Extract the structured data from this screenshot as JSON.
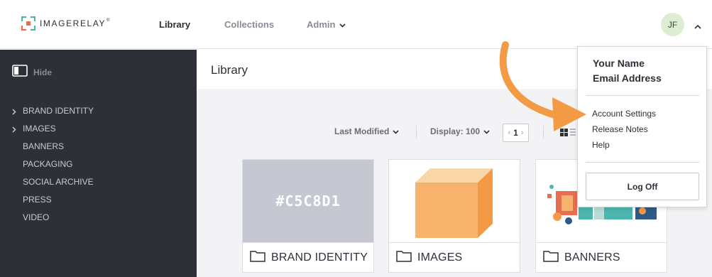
{
  "brand": {
    "name": "IMAGERELAY",
    "reg": "®"
  },
  "nav": {
    "library": "Library",
    "collections": "Collections",
    "admin": "Admin"
  },
  "user": {
    "initials": "JF"
  },
  "sidebar": {
    "hide_label": "Hide",
    "items": [
      {
        "label": "BRAND IDENTITY",
        "expandable": true
      },
      {
        "label": "IMAGES",
        "expandable": true
      },
      {
        "label": "BANNERS",
        "expandable": false
      },
      {
        "label": "PACKAGING",
        "expandable": false
      },
      {
        "label": "SOCIAL ARCHIVE",
        "expandable": false
      },
      {
        "label": "PRESS",
        "expandable": false
      },
      {
        "label": "VIDEO",
        "expandable": false
      }
    ]
  },
  "main": {
    "title": "Library",
    "sort_label": "Last Modified",
    "display_label": "Display: 100",
    "page_number": "1",
    "cards": [
      {
        "label": "BRAND IDENTITY",
        "swatch_text": "#C5C8D1"
      },
      {
        "label": "IMAGES"
      },
      {
        "label": "BANNERS"
      }
    ]
  },
  "dropdown": {
    "name": "Your Name",
    "email": "Email Address",
    "items": [
      "Account Settings",
      "Release Notes",
      "Help"
    ],
    "logoff": "Log Off"
  },
  "colors": {
    "sidebar_bg": "#2e3038",
    "swatch": "#c5c8d1",
    "avatar_bg": "#dcedd2",
    "annotation_arrow": "#f39a45"
  }
}
